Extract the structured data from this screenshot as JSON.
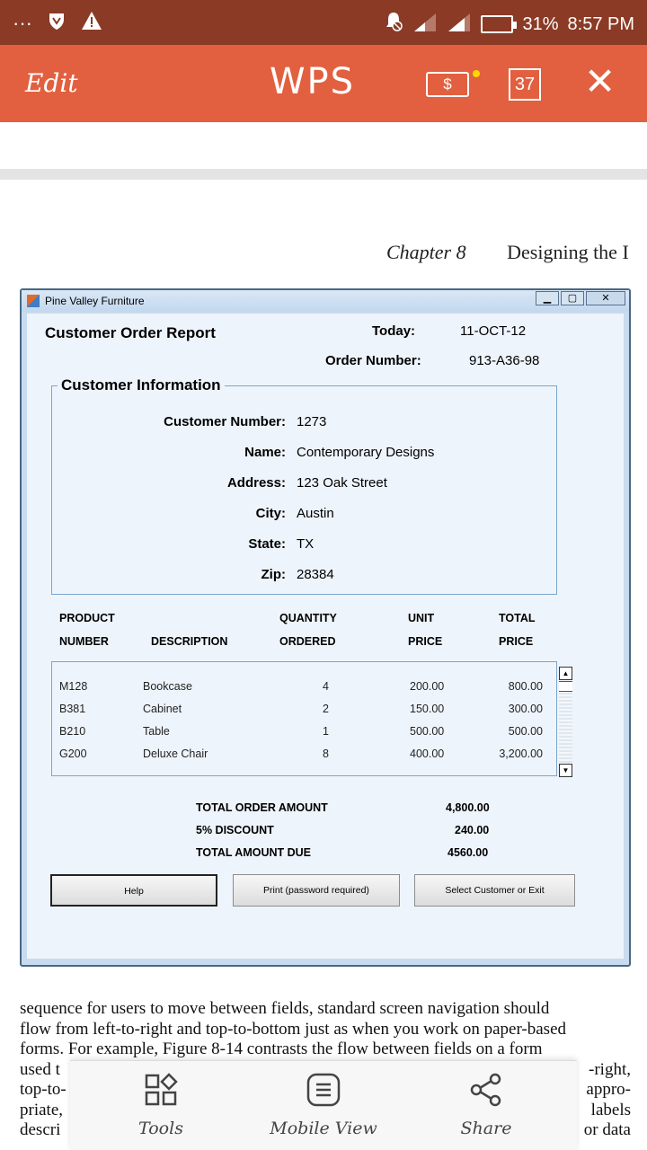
{
  "status_bar": {
    "dots": "···",
    "battery": "31%",
    "time": "8:57 PM"
  },
  "app_bar": {
    "edit_label": "Edit",
    "logo": "WPS",
    "money_label": "$",
    "page_count": "37",
    "close_label": "✕"
  },
  "page_header": {
    "chapter": "Chapter 8",
    "title": "Designing the I"
  },
  "window": {
    "title": "Pine Valley Furniture",
    "report_title": "Customer Order Report",
    "today_label": "Today:",
    "today_value": "11-OCT-12",
    "order_number_label": "Order Number:",
    "order_number_value": "913-A36-98",
    "customer_info": {
      "group_label": "Customer Information",
      "fields": [
        {
          "label": "Customer Number:",
          "value": "1273"
        },
        {
          "label": "Name:",
          "value": "Contemporary Designs"
        },
        {
          "label": "Address:",
          "value": "123 Oak Street"
        },
        {
          "label": "City:",
          "value": "Austin"
        },
        {
          "label": "State:",
          "value": "TX"
        },
        {
          "label": "Zip:",
          "value": "28384"
        }
      ]
    },
    "columns": {
      "product_1": "PRODUCT",
      "product_2": "NUMBER",
      "description": "DESCRIPTION",
      "quantity_1": "QUANTITY",
      "quantity_2": "ORDERED",
      "unit_1": "UNIT",
      "unit_2": "PRICE",
      "total_1": "TOTAL",
      "total_2": "PRICE"
    },
    "rows": [
      {
        "product": "M128",
        "description": "Bookcase",
        "quantity": "4",
        "unit_price": "200.00",
        "total_price": "800.00"
      },
      {
        "product": "B381",
        "description": "Cabinet",
        "quantity": "2",
        "unit_price": "150.00",
        "total_price": "300.00"
      },
      {
        "product": "B210",
        "description": "Table",
        "quantity": "1",
        "unit_price": "500.00",
        "total_price": "500.00"
      },
      {
        "product": "G200",
        "description": "Deluxe Chair",
        "quantity": "8",
        "unit_price": "400.00",
        "total_price": "3,200.00"
      }
    ],
    "totals": [
      {
        "label": "TOTAL ORDER AMOUNT",
        "value": "4,800.00"
      },
      {
        "label": "5% DISCOUNT",
        "value": "240.00"
      },
      {
        "label": "TOTAL AMOUNT DUE",
        "value": "4560.00"
      }
    ],
    "buttons": {
      "help": "Help",
      "print": "Print (password required)",
      "select": "Select Customer or Exit"
    }
  },
  "body_text": {
    "line1": "sequence for users to move between fields, standard screen navigation should",
    "line2": "flow from left-to-right and top-to-bottom just as when you work on paper-based",
    "line3": "forms. For example, Figure 8-14 contrasts the flow between fields on a form",
    "line4a": "used t",
    "line4b": "-right,",
    "line5a": "top-to-",
    "line5b": "appro-",
    "line6a": "priate,",
    "line6b": "labels",
    "line7a": "descri",
    "line7b": "or data"
  },
  "bottom_toolbar": {
    "tools": "Tools",
    "mobile_view": "Mobile View",
    "share": "Share"
  }
}
